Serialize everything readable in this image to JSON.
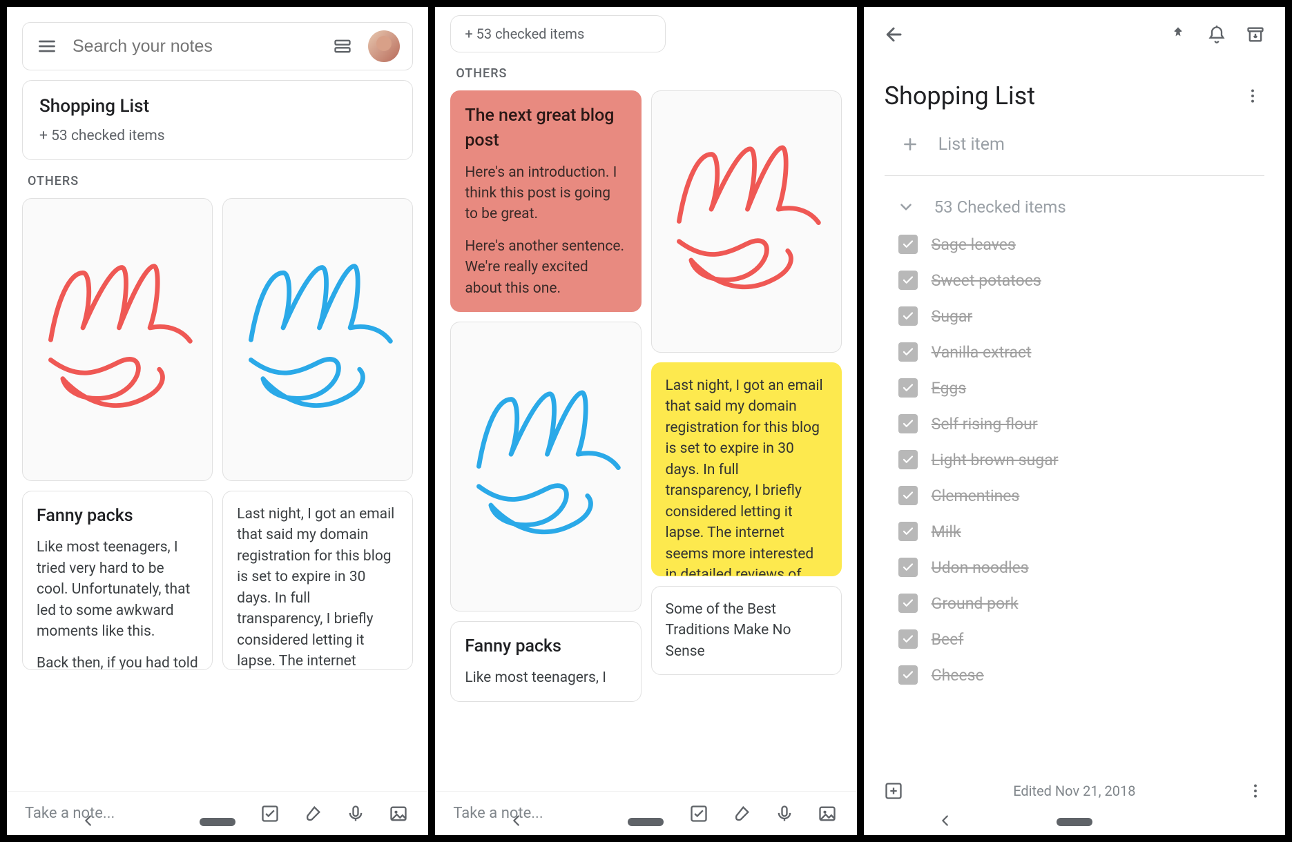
{
  "pane1": {
    "search_placeholder": "Search your notes",
    "pinned": {
      "title": "Shopping List",
      "subtitle": "+ 53 checked items"
    },
    "section_label": "OTHERS",
    "notes": {
      "fanny": {
        "title": "Fanny packs",
        "p1": "Like most teenagers, I tried very hard to be cool. Unfortunately, that led to some awkward moments like this.",
        "p2": "Back then, if you had told me that I'd enjoy"
      },
      "domain": {
        "p1": "Last night, I got an email that said my domain registration for this blog is set to expire in 30 days. In full transparency, I briefly considered letting it lapse. The internet seems more interested in detailed reviews of"
      }
    },
    "take_note": "Take a note..."
  },
  "pane2": {
    "pinned_sub": "+ 53 checked items",
    "section_label": "OTHERS",
    "blog": {
      "title": "The next great blog post",
      "p1": "Here's an introduction. I think this post is going to be great.",
      "p2": "Here's another sentence. We're really excited about this one."
    },
    "yellow": "Last night, I got an email that said my domain registration for this blog is set to expire in 30 days. In full transparency, I briefly considered letting it lapse. The internet seems more interested in detailed reviews of The Baconator than ru...",
    "fanny": {
      "title": "Fanny packs",
      "p1": "Like most teenagers, I"
    },
    "traditions": "Some of the Best Traditions Make No Sense",
    "take_note": "Take a note..."
  },
  "pane3": {
    "title": "Shopping List",
    "add_label": "List item",
    "checked_header": "53 Checked items",
    "items": [
      "Sage leaves",
      "Sweet potatoes",
      "Sugar",
      "Vanilla extract",
      "Eggs",
      "Self rising flour",
      "Light brown sugar",
      "Clementines",
      "Milk",
      "Udon noodles",
      "Ground pork",
      "Beef",
      "Cheese"
    ],
    "edited": "Edited Nov 21, 2018"
  }
}
